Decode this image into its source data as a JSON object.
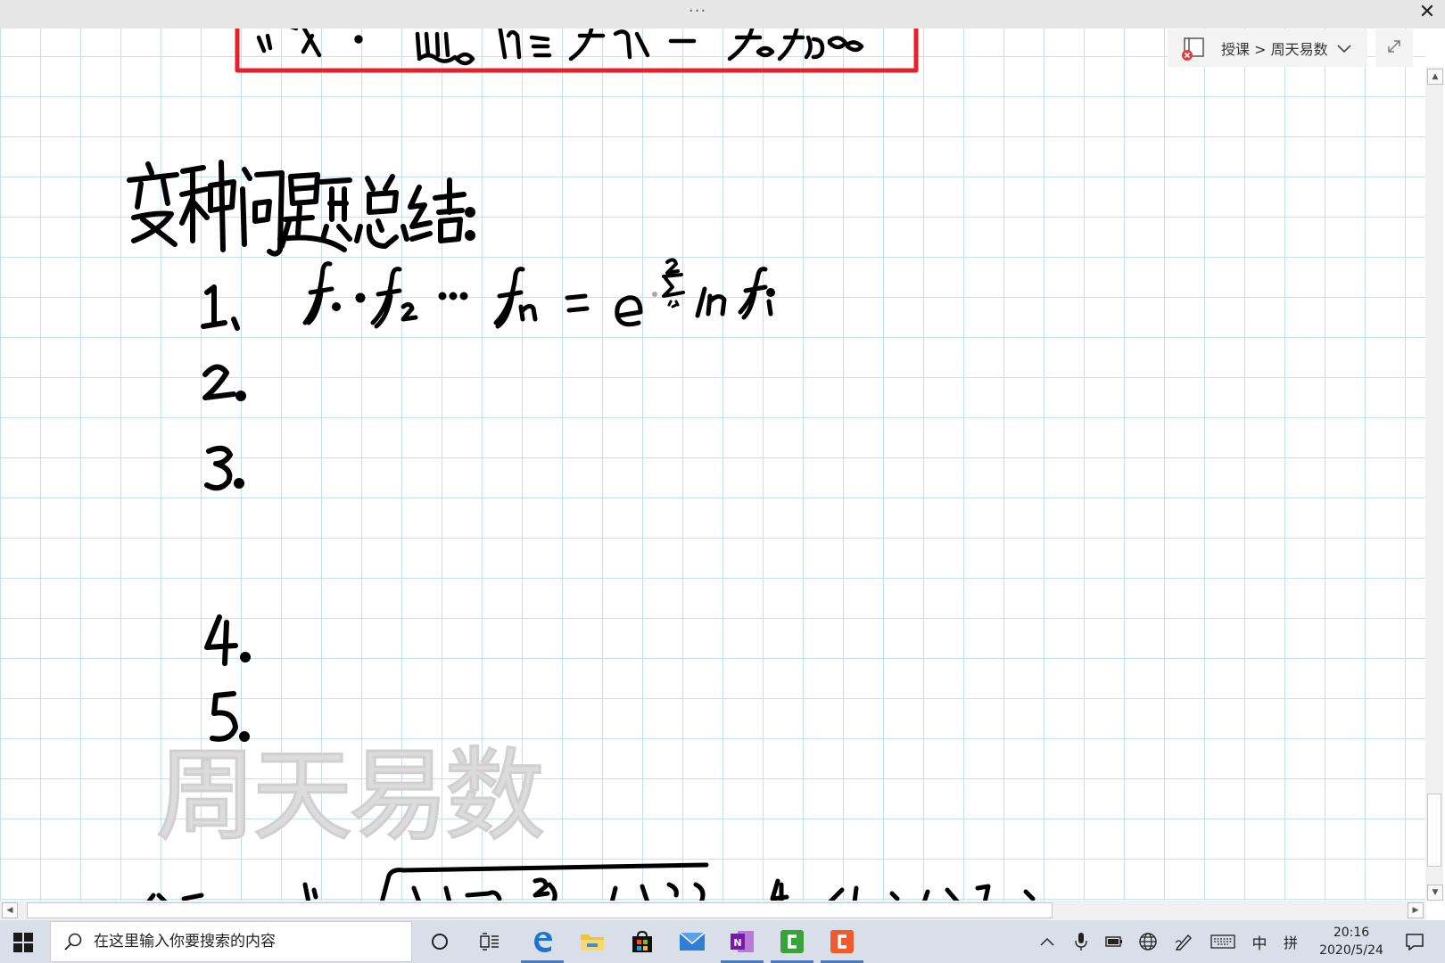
{
  "window": {
    "menu_dots": "···",
    "close_glyph": "✕"
  },
  "breadcrumb": {
    "text": "授课 > 周天易数",
    "icon": "notebook-sync-error-icon",
    "chevron": "chevron-down-icon"
  },
  "expand": {
    "icon": "expand-icon"
  },
  "note": {
    "heading": "变种问题总结:",
    "items": [
      {
        "number": "1.",
        "formula": "f₁·f₂ ··· fₙ = e^(Σᵢ₌₁ⁿ ln fᵢ)"
      },
      {
        "number": "2.",
        "formula": ""
      },
      {
        "number": "3.",
        "formula": ""
      },
      {
        "number": "4.",
        "formula": ""
      },
      {
        "number": "5.",
        "formula": ""
      }
    ],
    "watermark": "周天易数"
  },
  "taskbar": {
    "search_placeholder": "在这里输入你要搜索的内容",
    "apps": [
      "cortana-icon",
      "task-view-icon",
      "edge-icon",
      "file-explorer-icon",
      "store-icon",
      "mail-icon",
      "onenote-icon",
      "camtasia-green-icon",
      "camtasia-orange-icon"
    ],
    "tray": {
      "ime_mode": "中",
      "ime_layout": "拼"
    },
    "clock": {
      "time": "20:16",
      "date": "2020/5/24"
    }
  },
  "colors": {
    "grid": "#c3e2f0",
    "ink": "#000000",
    "box_border": "#e8202a",
    "taskbar": "#d8dfe9",
    "watermark": "#dcdcdc"
  }
}
